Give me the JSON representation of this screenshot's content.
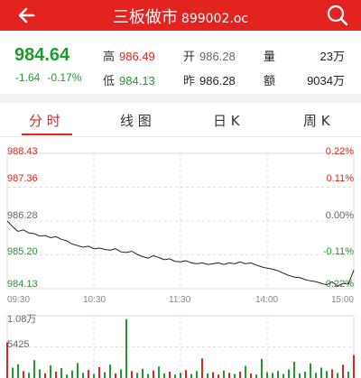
{
  "header": {
    "title": "三板做市",
    "code": "899002.oc",
    "back_icon": "back-arrow-icon",
    "search_icon": "search-icon",
    "bg_color": "#e3231f"
  },
  "quote": {
    "price": "984.64",
    "change": "-1.64",
    "change_pct": "-0.17%",
    "high_label": "高",
    "high": "986.49",
    "low_label": "低",
    "low": "984.13",
    "open_label": "开",
    "open": "986.28",
    "prev_close_label": "昨",
    "prev_close": "986.28",
    "volume_label": "量",
    "volume": "23万",
    "amount_label": "额",
    "amount": "9034万"
  },
  "tabs": [
    {
      "label": "分 时",
      "active": true
    },
    {
      "label": "线 图",
      "active": false
    },
    {
      "label": "日 K",
      "active": false
    },
    {
      "label": "周 K",
      "active": false
    }
  ],
  "chart_data": {
    "type": "line",
    "price_axis": [
      "988.43",
      "987.36",
      "986.28",
      "985.20",
      "984.13"
    ],
    "pct_axis": [
      "0.22%",
      "0.11%",
      "0.00%",
      "-0.11%",
      "-0.22%"
    ],
    "time_axis": [
      "09:30",
      "10:30",
      "11:30",
      "14:00",
      "15:00"
    ],
    "volume_axis": [
      "1.08万",
      "5425"
    ],
    "ylim": [
      984.13,
      988.43
    ],
    "prev_close": 986.28,
    "price": [
      986.28,
      986.1,
      985.95,
      986.0,
      985.9,
      985.88,
      985.8,
      985.82,
      985.75,
      985.78,
      985.7,
      985.65,
      985.55,
      985.5,
      985.45,
      985.48,
      985.4,
      985.42,
      985.38,
      985.35,
      985.4,
      985.3,
      985.28,
      985.32,
      985.22,
      985.15,
      985.1,
      985.18,
      985.12,
      985.05,
      985.08,
      985.0,
      984.98,
      985.02,
      984.95,
      984.92,
      984.95,
      984.9,
      984.92,
      984.95,
      984.9,
      984.95,
      984.92,
      984.98,
      984.92,
      984.95,
      984.88,
      984.82,
      984.78,
      984.75,
      984.7,
      984.62,
      984.55,
      984.5,
      984.48,
      984.42,
      984.38,
      984.35,
      984.3,
      984.25,
      984.35,
      984.22,
      984.3,
      984.28,
      984.72
    ],
    "volume": [
      6200,
      1800,
      2400,
      1200,
      900,
      3100,
      1500,
      800,
      2200,
      1100,
      1700,
      600,
      1300,
      2600,
      900,
      1400,
      700,
      1900,
      1000,
      2300,
      800,
      1500,
      10200,
      1200,
      900,
      1600,
      700,
      1300,
      2000,
      800,
      1100,
      600,
      900,
      1400,
      700,
      1200,
      3400,
      800,
      1000,
      600,
      1300,
      900,
      700,
      1100,
      2100,
      800,
      600,
      3300,
      1000,
      900,
      1200,
      700,
      1500,
      2800,
      800,
      1100,
      2500,
      900,
      1800,
      1200,
      1500,
      900,
      2300,
      1100,
      4000
    ],
    "volume_max": 10800
  }
}
